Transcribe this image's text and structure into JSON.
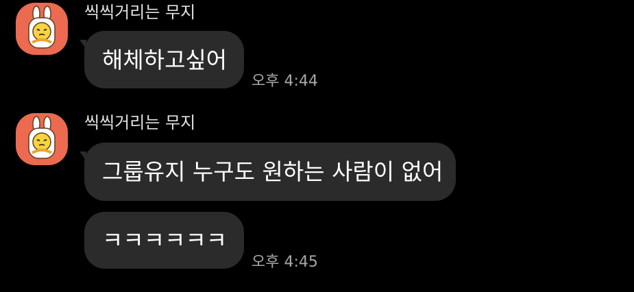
{
  "messages": [
    {
      "sender": "씩씩거리는 무지",
      "avatar_icon": "muzi-avatar-icon",
      "bubbles": [
        "해체하고싶어"
      ],
      "time": "오후 4:44"
    },
    {
      "sender": "씩씩거리는 무지",
      "avatar_icon": "muzi-avatar-icon",
      "bubbles": [
        "그룹유지 누구도 원하는 사람이 없어",
        "ㅋㅋㅋㅋㅋㅋ"
      ],
      "time": "오후 4:45"
    }
  ],
  "colors": {
    "background": "#000000",
    "bubble": "#2b2b2b",
    "avatar_bg": "#ec6a4f",
    "timestamp": "#a8a8a8"
  }
}
